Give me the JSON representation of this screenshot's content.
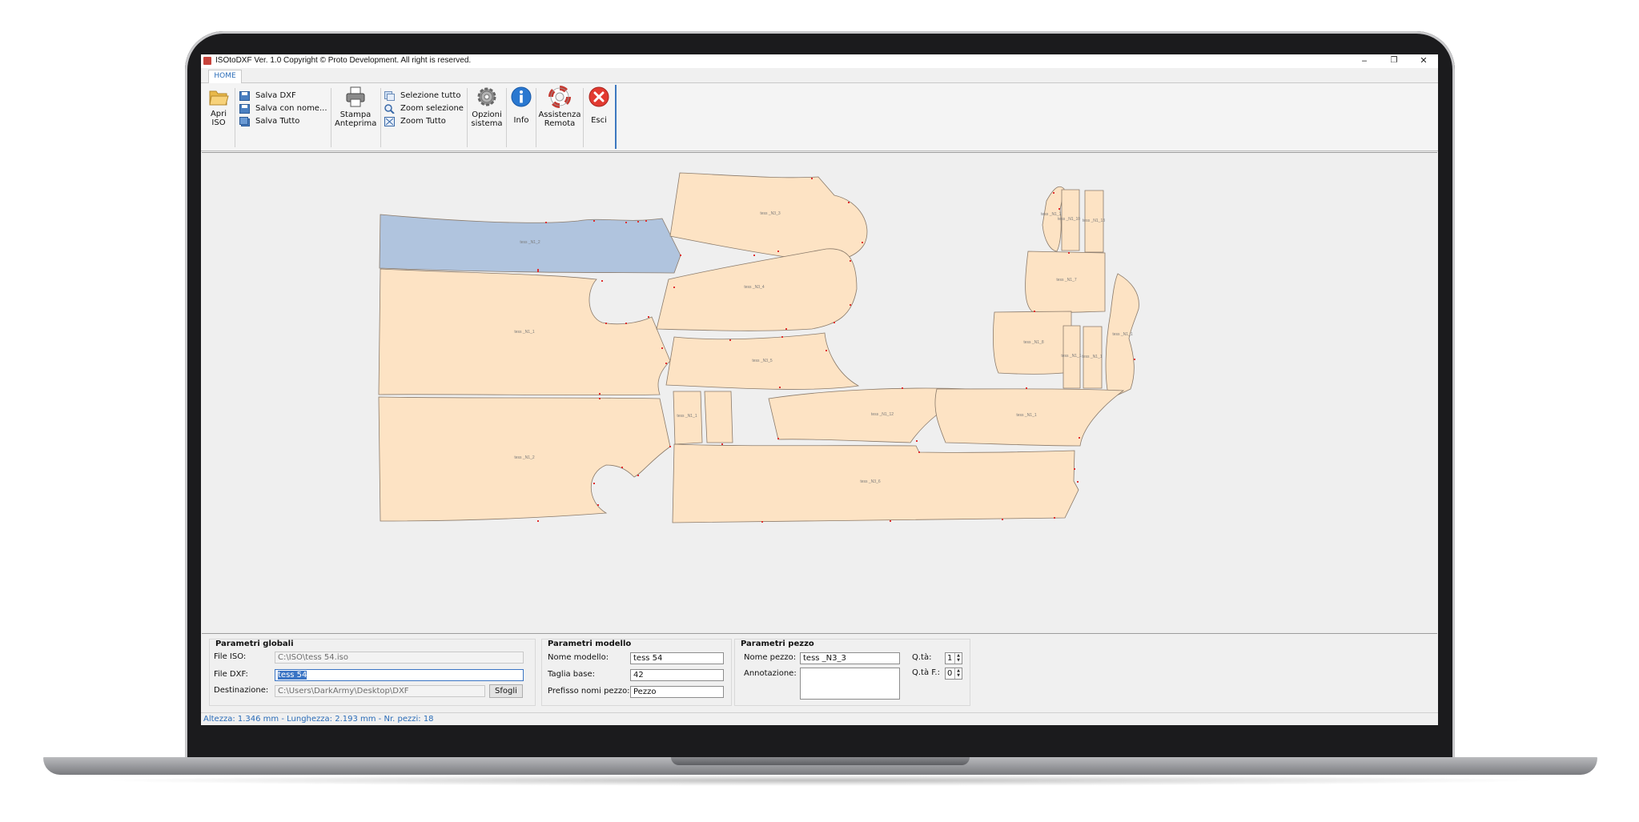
{
  "window": {
    "title": "ISOtoDXF Ver. 1.0 Copyright © Proto Development. All right is reserved.",
    "minimize": "‒",
    "restore": "❐",
    "close": "✕"
  },
  "tabs": {
    "home": "HOME"
  },
  "ribbon": {
    "open_iso": [
      "Apri",
      "ISO"
    ],
    "save_dxf": "Salva DXF",
    "save_as": "Salva con nome...",
    "save_all": "Salva Tutto",
    "print_preview": [
      "Stampa",
      "Anteprima"
    ],
    "select_all": "Selezione tutto",
    "zoom_selection": "Zoom selezione",
    "zoom_all": "Zoom Tutto",
    "system_options": [
      "Opzioni",
      "sistema"
    ],
    "info": "Info",
    "remote_assist": [
      "Assistenza",
      "Remota"
    ],
    "exit": "Esci",
    "icons": {
      "open_iso": "folder-open-icon",
      "save_dxf": "floppy-icon",
      "print": "printer-icon",
      "select_all": "select-all-icon",
      "zoom_selection": "zoom-icon",
      "zoom_all": "zoom-extents-icon",
      "options": "gear-icon",
      "info": "info-icon",
      "remote": "lifebuoy-icon",
      "exit": "close-icon"
    }
  },
  "colors": {
    "piece_fill": "#fde3c4",
    "piece_selected_fill": "#b0c4de",
    "piece_stroke": "#8a7a6a",
    "notch": "#e03030",
    "accent": "#3a74c4"
  },
  "pieces": [
    {
      "label": "tess _N1_2",
      "selected": true
    },
    {
      "label": "tess _N3_3",
      "selected": false
    },
    {
      "label": "tess _N1_1",
      "selected": false
    },
    {
      "label": "tess _N3_4",
      "selected": false
    },
    {
      "label": "tess _N3_5",
      "selected": false
    },
    {
      "label": "tess _N1_2",
      "selected": false
    },
    {
      "label": "tess _N3_6",
      "selected": false
    },
    {
      "label": "tess _N1_12",
      "selected": false
    },
    {
      "label": "tess _N1_11",
      "selected": false
    },
    {
      "label": "tess _N1_10",
      "selected": false
    },
    {
      "label": "tess _N1_13",
      "selected": false
    },
    {
      "label": "tess _N1_7",
      "selected": false
    },
    {
      "label": "tess _N1_8",
      "selected": false
    },
    {
      "label": "tess _N1_1",
      "selected": false
    },
    {
      "label": "tess _N1_1",
      "selected": false
    },
    {
      "label": "tess _N1_1",
      "selected": false
    },
    {
      "label": "tess _N1_1",
      "selected": false
    },
    {
      "label": "tess _N1_1",
      "selected": false
    }
  ],
  "global_params": {
    "title": "Parametri globali",
    "file_iso_label": "File ISO:",
    "file_iso_value": "C:\\ISO\\tess 54.iso",
    "file_dxf_label": "File DXF:",
    "file_dxf_value": "tess 54",
    "destination_label": "Destinazione:",
    "destination_value": "C:\\Users\\DarkArmy\\Desktop\\DXF",
    "browse_button": "Sfogli"
  },
  "model_params": {
    "title": "Parametri modello",
    "model_name_label": "Nome modello:",
    "model_name_value": "tess 54",
    "base_size_label": "Taglia base:",
    "base_size_value": "42",
    "prefix_label": "Prefisso nomi pezzo:",
    "prefix_value": "Pezzo"
  },
  "piece_params": {
    "title": "Parametri pezzo",
    "piece_name_label": "Nome pezzo:",
    "piece_name_value": "tess _N3_3",
    "annotation_label": "Annotazione:",
    "annotation_value": "",
    "qty_label": "Q.tà:",
    "qty_value": "1",
    "qty_f_label": "Q.tà F.:",
    "qty_f_value": "0"
  },
  "status": "Altezza: 1.346 mm - Lunghezza: 2.193 mm - Nr. pezzi: 18"
}
